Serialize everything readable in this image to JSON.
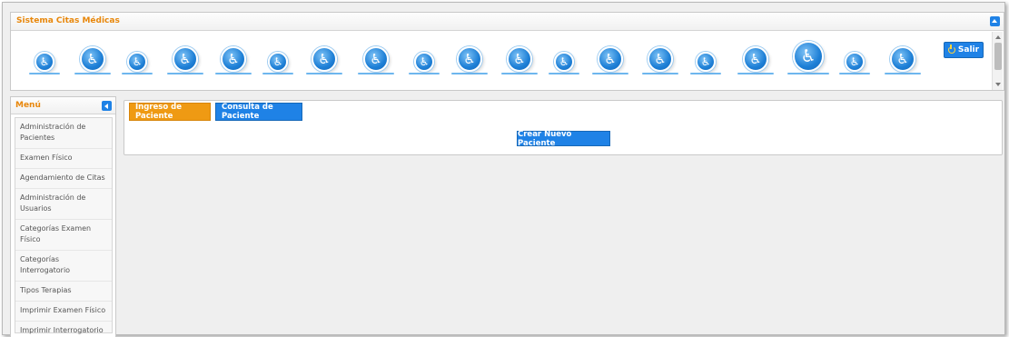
{
  "header": {
    "title": "Sistema Citas Médicas",
    "logout_label": "Salir",
    "decor_icon": "wheelchair-icon",
    "decor_count": 19
  },
  "sidebar": {
    "title": "Menú",
    "items": [
      {
        "label": "Administración de Pacientes"
      },
      {
        "label": "Examen Físico"
      },
      {
        "label": "Agendamiento de Citas"
      },
      {
        "label": "Administración de Usuarios"
      },
      {
        "label": "Categorías Examen Físico"
      },
      {
        "label": "Categorías Interrogatorio"
      },
      {
        "label": "Tipos Terapias"
      },
      {
        "label": "Imprimir Examen Físico"
      },
      {
        "label": "Imprimir Interrogatorio"
      }
    ]
  },
  "main": {
    "tabs": [
      {
        "label": "Ingreso de Paciente",
        "color": "#ef9a13"
      },
      {
        "label": "Consulta de Paciente",
        "color": "#1f82e6"
      }
    ],
    "create_label": "Crear Nuevo Paciente"
  },
  "colors": {
    "accent_orange": "#e8870b",
    "accent_blue": "#1f82e6"
  }
}
